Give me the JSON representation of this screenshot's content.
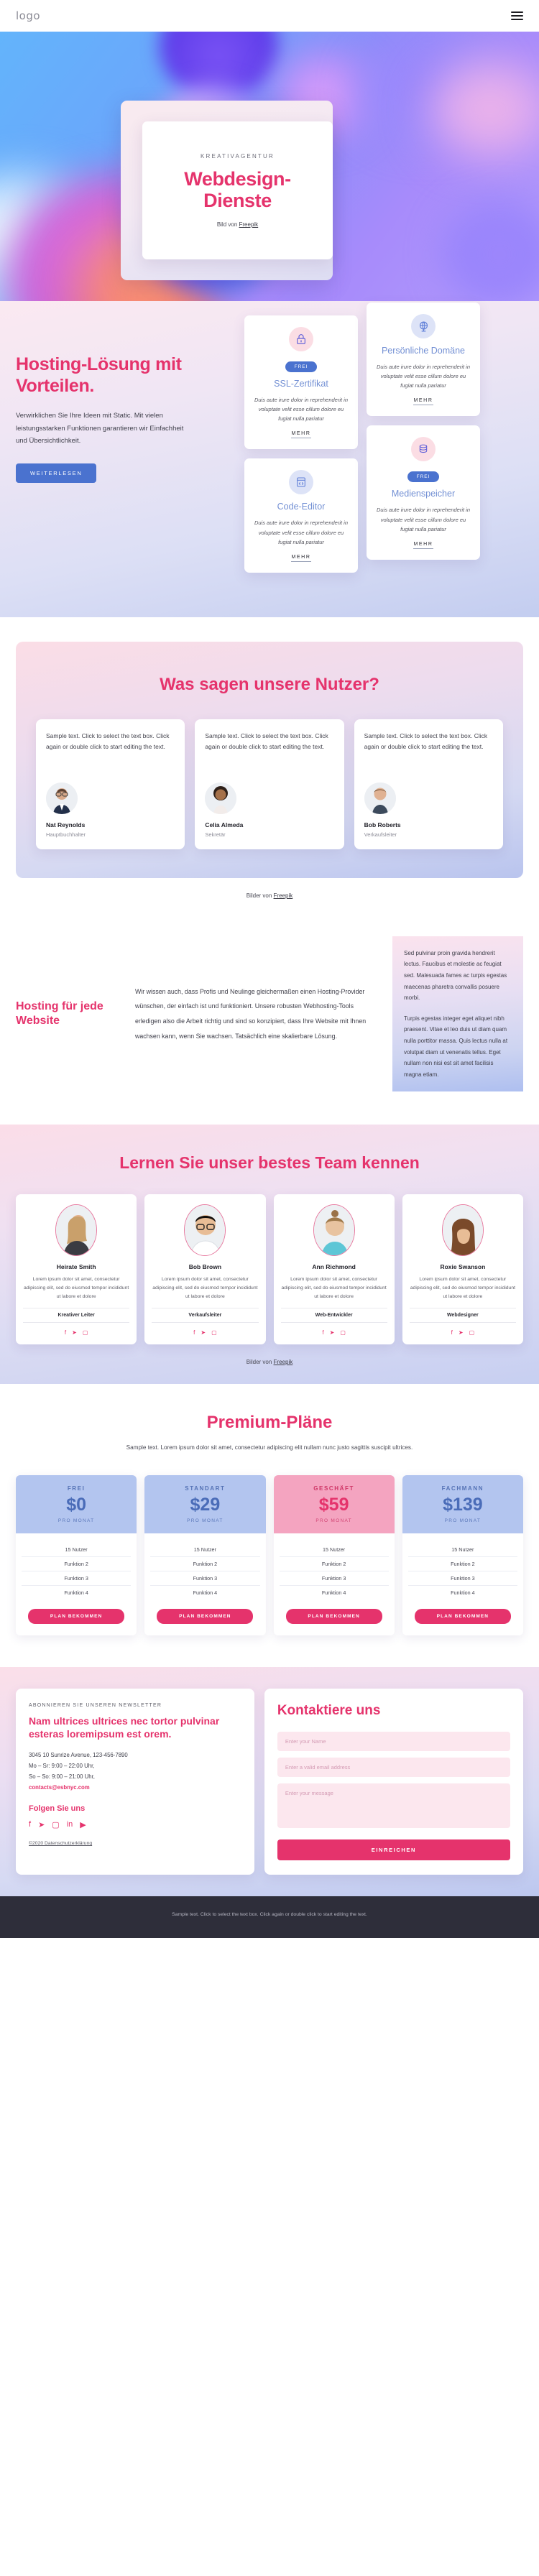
{
  "header": {
    "logo": "logo",
    "menu_icon": "hamburger-menu-icon"
  },
  "hero": {
    "kicker": "KREATIVAGENTUR",
    "title_line1": "Webdesign-",
    "title_line2": "Dienste",
    "credit_prefix": "Bild von ",
    "credit_link": "Freepik"
  },
  "hosting": {
    "title": "Hosting-Lösung mit Vorteilen.",
    "body": "Verwirklichen Sie Ihre Ideen mit Static. Mit vielen leistungsstarken Funktionen garantieren wir Einfachheit und Übersichtlichkeit.",
    "cta": "WEITERLESEN",
    "cards": [
      {
        "icon": "lock-icon",
        "icon_tone": "pink",
        "badge": "FREI",
        "title": "SSL-Zertifikat",
        "desc": "Duis aute irure dolor in reprehenderit in voluptate velit esse cillum dolore eu fugiat nulla pariatur",
        "more": "MEHR"
      },
      {
        "icon": "globe-icon",
        "icon_tone": "blue",
        "badge": "",
        "title": "Persönliche Domäne",
        "desc": "Duis aute irure dolor in reprehenderit in voluptate velit esse cillum dolore eu fugiat nulla pariatur",
        "more": "MEHR"
      },
      {
        "icon": "code-window-icon",
        "icon_tone": "blue",
        "badge": "",
        "title": "Code-Editor",
        "desc": "Duis aute irure dolor in reprehenderit in voluptate velit esse cillum dolore eu fugiat nulla pariatur",
        "more": "MEHR"
      },
      {
        "icon": "database-icon",
        "icon_tone": "pink",
        "badge": "FREI",
        "title": "Medienspeicher",
        "desc": "Duis aute irure dolor in reprehenderit in voluptate velit esse cillum dolore eu fugiat nulla pariatur",
        "more": "MEHR"
      }
    ]
  },
  "testimonials": {
    "heading": "Was sagen unsere Nutzer?",
    "credit_prefix": "Bilder von ",
    "credit_link": "Freepik",
    "items": [
      {
        "text": "Sample text. Click to select the text box. Click again or double click to start editing the text.",
        "name": "Nat Reynolds",
        "role": "Hauptbuchhalter"
      },
      {
        "text": "Sample text. Click to select the text box. Click again or double click to start editing the text.",
        "name": "Celia Almeda",
        "role": "Sekretär"
      },
      {
        "text": "Sample text. Click to select the text box. Click again or double click to start editing the text.",
        "name": "Bob Roberts",
        "role": "Verkaufsleiter"
      }
    ]
  },
  "hosting_for_every": {
    "title": "Hosting für jede Website",
    "body": "Wir wissen auch, dass Profis und Neulinge gleichermaßen einen Hosting-Provider wünschen, der einfach ist und funktioniert. Unsere robusten Webhosting-Tools erledigen also die Arbeit richtig und sind so konzipiert, dass Ihre Website mit Ihnen wachsen kann, wenn Sie wachsen. Tatsächlich eine skalierbare Lösung.",
    "side_p1": "Sed pulvinar proin gravida hendrerit lectus. Faucibus et molestie ac feugiat sed. Malesuada fames ac turpis egestas maecenas pharetra convallis posuere morbi.",
    "side_p2": "Turpis egestas integer eget aliquet nibh praesent. Vitae et leo duis ut diam quam nulla porttitor massa. Quis lectus nulla at volutpat diam ut venenatis tellus. Eget nullam non nisi est sit amet facilisis magna etiam."
  },
  "team": {
    "heading": "Lernen Sie unser bestes Team kennen",
    "credit_prefix": "Bilder von ",
    "credit_link": "Freepik",
    "members": [
      {
        "name": "Heirate Smith",
        "desc": "Lorem ipsum dolor sit amet, consectetur adipiscing elit, sed do eiusmod tempor incididunt ut labore et dolore",
        "role": "Kreativer Leiter"
      },
      {
        "name": "Bob Brown",
        "desc": "Lorem ipsum dolor sit amet, consectetur adipiscing elit, sed do eiusmod tempor incididunt ut labore et dolore",
        "role": "Verkaufsleiter"
      },
      {
        "name": "Ann Richmond",
        "desc": "Lorem ipsum dolor sit amet, consectetur adipiscing elit, sed do eiusmod tempor incididunt ut labore et dolore",
        "role": "Web-Entwickler"
      },
      {
        "name": "Roxie Swanson",
        "desc": "Lorem ipsum dolor sit amet, consectetur adipiscing elit, sed do eiusmod tempor incididunt ut labore et dolore",
        "role": "Webdesigner"
      }
    ],
    "social_icons": [
      "facebook-icon",
      "twitter-icon",
      "instagram-icon"
    ]
  },
  "pricing": {
    "heading": "Premium-Pläne",
    "subtitle": "Sample text. Lorem ipsum dolor sit amet, consectetur adipiscing elit nullam nunc justo sagittis suscipit ultrices.",
    "plans": [
      {
        "name": "FREI",
        "price": "$0",
        "per": "PRO MONAT",
        "tone": "blue",
        "features": [
          "15 Nutzer",
          "Funktion 2",
          "Funktion 3",
          "Funktion 4"
        ],
        "cta": "PLAN BEKOMMEN"
      },
      {
        "name": "STANDART",
        "price": "$29",
        "per": "PRO MONAT",
        "tone": "blue",
        "features": [
          "15 Nutzer",
          "Funktion 2",
          "Funktion 3",
          "Funktion 4"
        ],
        "cta": "PLAN BEKOMMEN"
      },
      {
        "name": "GESCHÄFT",
        "price": "$59",
        "per": "PRO MONAT",
        "tone": "pink",
        "features": [
          "15 Nutzer",
          "Funktion 2",
          "Funktion 3",
          "Funktion 4"
        ],
        "cta": "PLAN BEKOMMEN"
      },
      {
        "name": "FACHMANN",
        "price": "$139",
        "per": "PRO MONAT",
        "tone": "blue",
        "features": [
          "15 Nutzer",
          "Funktion 2",
          "Funktion 3",
          "Funktion 4"
        ],
        "cta": "PLAN BEKOMMEN"
      }
    ]
  },
  "footer": {
    "newsletter_kicker": "ABONNIEREN SIE UNSEREN NEWSLETTER",
    "newsletter_title": "Nam ultrices ultrices nec tortor pulvinar esteras loremipsum est orem.",
    "address_line1": "3045 10 Sunrize Avenue, 123-456-7890",
    "address_line2": "Mo – Sr: 9:00 – 22:00 Uhr,",
    "address_line3": "So – So: 9:00 – 21:00 Uhr,",
    "email": "contacts@esbnyc.com",
    "follow_title": "Folgen Sie uns",
    "social_icons": [
      "facebook-icon",
      "twitter-icon",
      "instagram-icon",
      "linkedin-icon",
      "youtube-icon"
    ],
    "copyright": "©2020 Datenschutzerklärung",
    "contact_title": "Kontaktiere uns",
    "name_placeholder": "Enter your Name",
    "email_placeholder": "Enter a valid email address",
    "message_placeholder": "Enter your message",
    "submit": "EINREICHEN"
  },
  "bottom_bar": {
    "text": "Sample text. Click to select the text box. Click again or double click to start editing the text."
  }
}
